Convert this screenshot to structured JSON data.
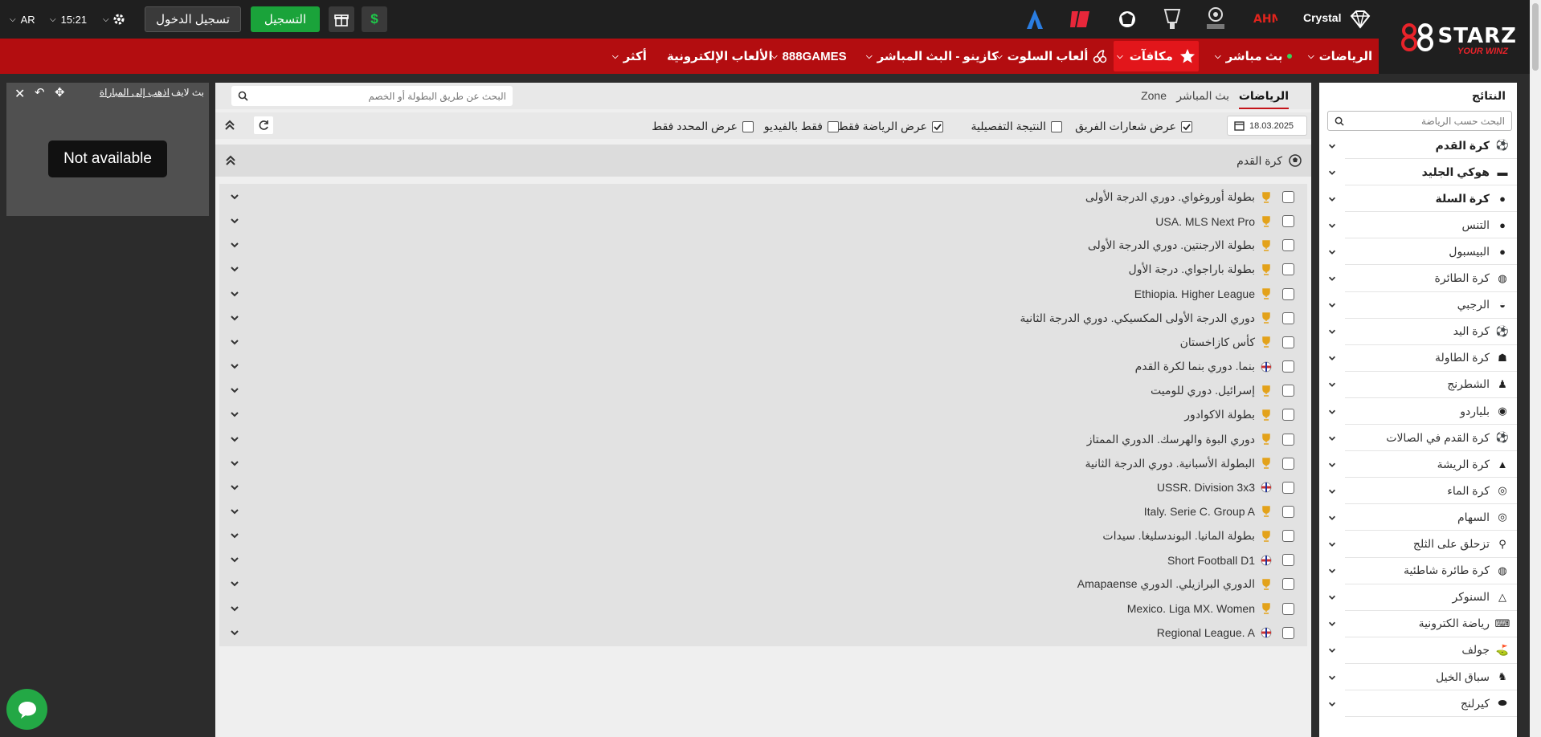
{
  "topbar": {
    "lang": "AR",
    "time": "15:21",
    "login": "تسجيل الدخول",
    "register": "التسجيل",
    "user": "Crystal",
    "currency_icon": "$"
  },
  "brand": {
    "logo_main": "888STARZ",
    "logo_sub": "YOUR WINZ"
  },
  "nav": {
    "items": [
      "الرياضات",
      "بث مباشر",
      "مكافآت",
      "ألعاب السلوت",
      "كازينو - البث المباشر",
      "888GAMES",
      "الألعاب الإلكترونية",
      "أكثر"
    ]
  },
  "live": {
    "title": "بث لايف",
    "link": "اذهب إلى المباراة",
    "not_available": "Not available"
  },
  "main": {
    "tabs": [
      "الرياضات",
      "بث المباشر",
      "Zone"
    ],
    "search_placeholder": "البحث عن طريق البطولة أو الخصم",
    "date": "18.03.2025",
    "filters": [
      "عرض شعارات الفريق",
      "النتيجة التفصيلية",
      "عرض الرياضة فقط",
      "فقط بالفيديو",
      "عرض المحدد فقط"
    ],
    "section_title": "كرة القدم",
    "leagues": [
      "بطولة أوروغواي. دوري الدرجة الأولى",
      "USA. MLS Next Pro",
      "بطولة الارجنتين. دوري الدرجة الأولى",
      "بطولة باراجواي. درجة الأول",
      "Ethiopia. Higher League",
      "دوري الدرجة الأولى المكسيكي. دوري الدرجة الثانية",
      "كأس كازاخستان",
      "بنما. دوري بنما لكرة القدم",
      "إسرائيل. دوري للوميت",
      "بطولة الاكوادور",
      "دوري البوة والهرسك. الدوري الممتاز",
      "البطولة الأسبانية. دوري الدرجة الثانية",
      "USSR. Division 3x3",
      "Italy. Serie C. Group A",
      "بطولة المانيا. البوندسليغا. سيدات",
      "Short Football D1",
      "الدوري البرازيلي. الدوري Amapaense",
      "Mexico. Liga MX. Women",
      "Regional League. A"
    ]
  },
  "results": {
    "title": "النتائج",
    "search_placeholder": "البحث حسب الرياضة",
    "sports": [
      "كرة القدم",
      "هوكي الجليد",
      "كرة السلة",
      "التنس",
      "البيسبول",
      "كرة الطائرة",
      "الرجبي",
      "كرة اليد",
      "كرة الطاولة",
      "الشطرنج",
      "بلياردو",
      "كرة القدم في الصالات",
      "كرة الريشة",
      "كرة الماء",
      "السهام",
      "تزحلق على الثلج",
      "كرة طائرة شاطئية",
      "السنوكر",
      "رياضة الكترونية",
      "جولف",
      "سباق الخيل",
      "كيرلنج"
    ]
  }
}
